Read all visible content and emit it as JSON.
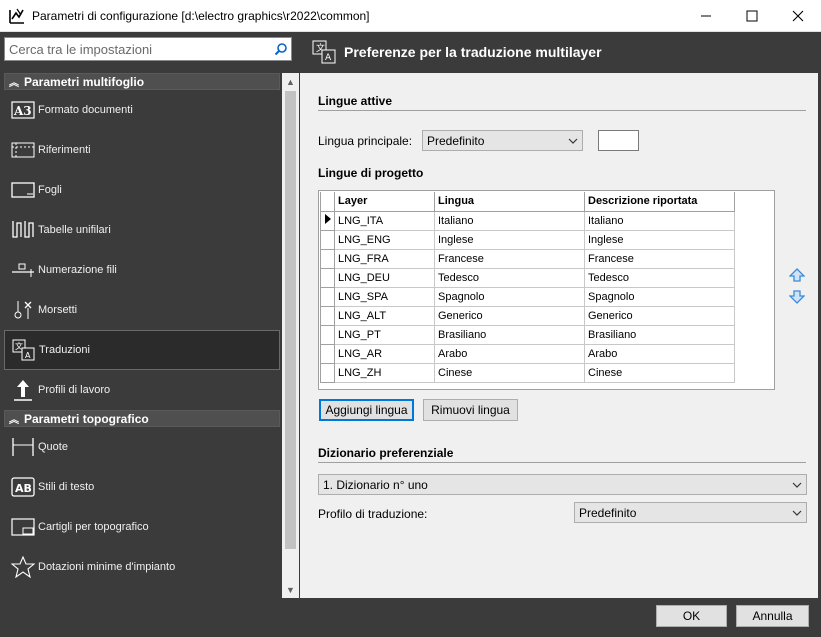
{
  "window": {
    "title": "Parametri di configurazione [d:\\electro graphics\\r2022\\common]"
  },
  "search": {
    "placeholder": "Cerca tra le impostazioni"
  },
  "sidebar": {
    "sections": [
      {
        "label": "Parametri multifoglio",
        "items": [
          {
            "label": "Formato documenti",
            "icon": "a3-format-icon"
          },
          {
            "label": "Riferimenti",
            "icon": "references-icon"
          },
          {
            "label": "Fogli",
            "icon": "sheet-icon"
          },
          {
            "label": "Tabelle unifilari",
            "icon": "single-line-table-icon"
          },
          {
            "label": "Numerazione fili",
            "icon": "wire-numbering-icon"
          },
          {
            "label": "Morsetti",
            "icon": "terminals-icon"
          },
          {
            "label": "Traduzioni",
            "icon": "translation-icon",
            "selected": true
          },
          {
            "label": "Profili di lavoro",
            "icon": "upload-profile-icon"
          }
        ]
      },
      {
        "label": "Parametri topografico",
        "items": [
          {
            "label": "Quote",
            "icon": "dimension-icon"
          },
          {
            "label": "Stili di testo",
            "icon": "text-style-icon"
          },
          {
            "label": "Cartigli per topografico",
            "icon": "title-block-icon"
          },
          {
            "label": "Dotazioni minime d'impianto",
            "icon": "star-icon"
          }
        ]
      }
    ]
  },
  "panel": {
    "title": "Preferenze per la traduzione multilayer",
    "lingue_attive": {
      "title": "Lingue attive",
      "primary_label": "Lingua principale:",
      "primary_value": "Predefinito",
      "primary_code": ""
    },
    "lingue_progetto": {
      "title": "Lingue di progetto",
      "columns": [
        "Layer",
        "Lingua",
        "Descrizione riportata"
      ],
      "rows": [
        [
          "LNG_ITA",
          "Italiano",
          "Italiano"
        ],
        [
          "LNG_ENG",
          "Inglese",
          "Inglese"
        ],
        [
          "LNG_FRA",
          "Francese",
          "Francese"
        ],
        [
          "LNG_DEU",
          "Tedesco",
          "Tedesco"
        ],
        [
          "LNG_SPA",
          "Spagnolo",
          "Spagnolo"
        ],
        [
          "LNG_ALT",
          "Generico",
          "Generico"
        ],
        [
          "LNG_PT",
          "Brasiliano",
          "Brasiliano"
        ],
        [
          "LNG_AR",
          "Arabo",
          "Arabo"
        ],
        [
          "LNG_ZH",
          "Cinese",
          "Cinese"
        ]
      ],
      "add_label": "Aggiungi lingua",
      "remove_label": "Rimuovi lingua"
    },
    "dizionario": {
      "title": "Dizionario preferenziale",
      "value": "1. Dizionario n° uno",
      "profile_label": "Profilo di traduzione:",
      "profile_value": "Predefinito"
    }
  },
  "footer": {
    "ok_label": "OK",
    "cancel_label": "Annulla"
  },
  "colors": {
    "dark_bg": "#3b3b3b",
    "content_bg": "#f0f0f0",
    "accent": "#0078d7",
    "arrow_blue": "#3a8ad8"
  }
}
